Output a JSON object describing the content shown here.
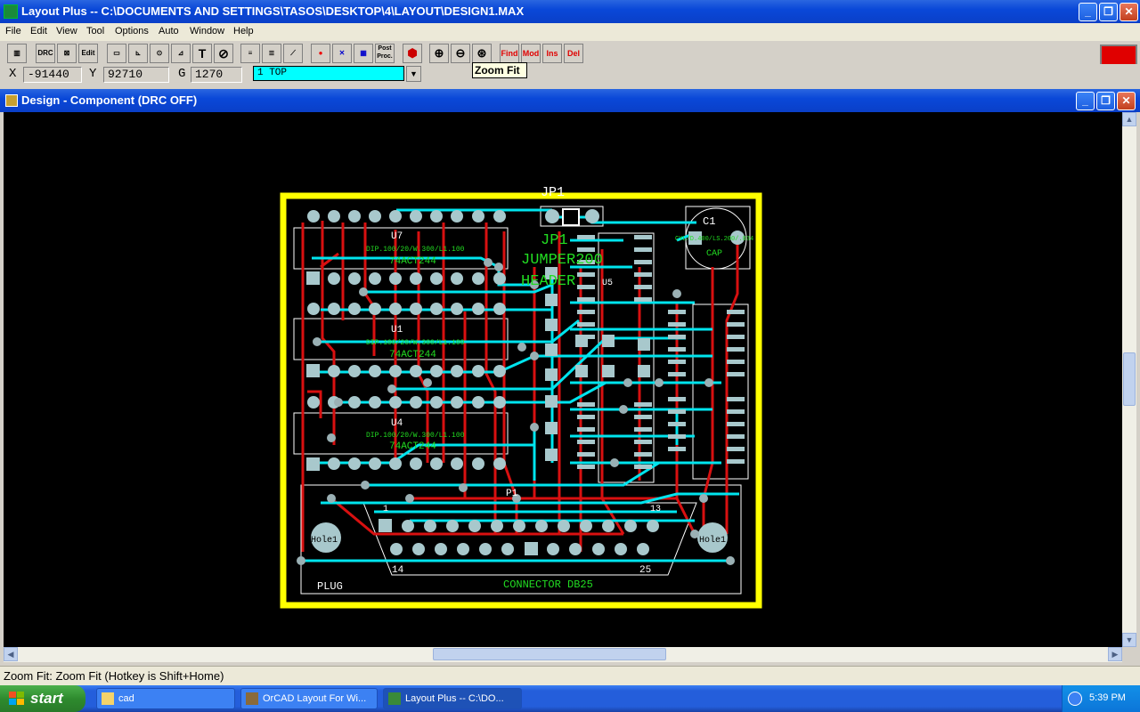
{
  "app": {
    "title": "Layout Plus -- C:\\DOCUMENTS AND SETTINGS\\TASOS\\DESKTOP\\4\\LAYOUT\\DESIGN1.MAX"
  },
  "menu": [
    "File",
    "Edit",
    "View",
    "Tool",
    "Options",
    "Auto",
    "Window",
    "Help"
  ],
  "toolbar": {
    "drc_label": "DRC",
    "edit_label": "Edit",
    "text_tool_label": "T",
    "post_proc_label": "Post Proc.",
    "find_label": "Find",
    "mod_label": "Mod",
    "ins_label": "Ins",
    "del_label": "Del",
    "tooltip": "Zoom Fit"
  },
  "coords": {
    "x_label": "X",
    "x_value": "-91440",
    "y_label": "Y",
    "y_value": "92710",
    "g_label": "G",
    "g_value": "1270",
    "layer_value": "1  TOP"
  },
  "design_window": {
    "title": "Design - Component (DRC OFF)"
  },
  "board": {
    "labels": {
      "jp1": "JP1",
      "jp1_value": "JP1",
      "jumper_label": "JUMPER200",
      "header_label": "HEADER",
      "c1": "C1",
      "c1_footprint": "CYL/D.400/LS.200/.034",
      "cap": "CAP",
      "u7": "U7",
      "u7_footprint": "DIP.100/20/W.300/L1.100",
      "u7_part": "74ACT244",
      "u1": "U1",
      "u1_footprint": "DIP.100/20/W.300/L1.100",
      "u1_part": "74ACT244",
      "u4": "U4",
      "u4_footprint": "DIP.100/20/W.300/L1.100",
      "u4_part": "74ACT244",
      "p1": "P1",
      "pin1": "1",
      "pin13": "13",
      "pin14": "14",
      "pin25": "25",
      "hole_left": "Hole1",
      "hole_right": "Hole1",
      "plug": "PLUG",
      "connector": "CONNECTOR DB25",
      "u5": "U5"
    }
  },
  "statusbar": {
    "text": "Zoom Fit: Zoom Fit (Hotkey is Shift+Home)"
  },
  "taskbar": {
    "start_label": "start",
    "buttons": [
      "cad",
      "OrCAD Layout For Wi...",
      "Layout Plus -- C:\\DO..."
    ],
    "clock": "5:39 PM"
  },
  "colors": {
    "board_outline": "#ffff00",
    "trace_top": "#00e5ee",
    "trace_bottom": "#e01010",
    "silk": "#ffffff",
    "text_green": "#22dd22",
    "pad": "#a8c8cc",
    "canvas_bg": "#000000"
  }
}
